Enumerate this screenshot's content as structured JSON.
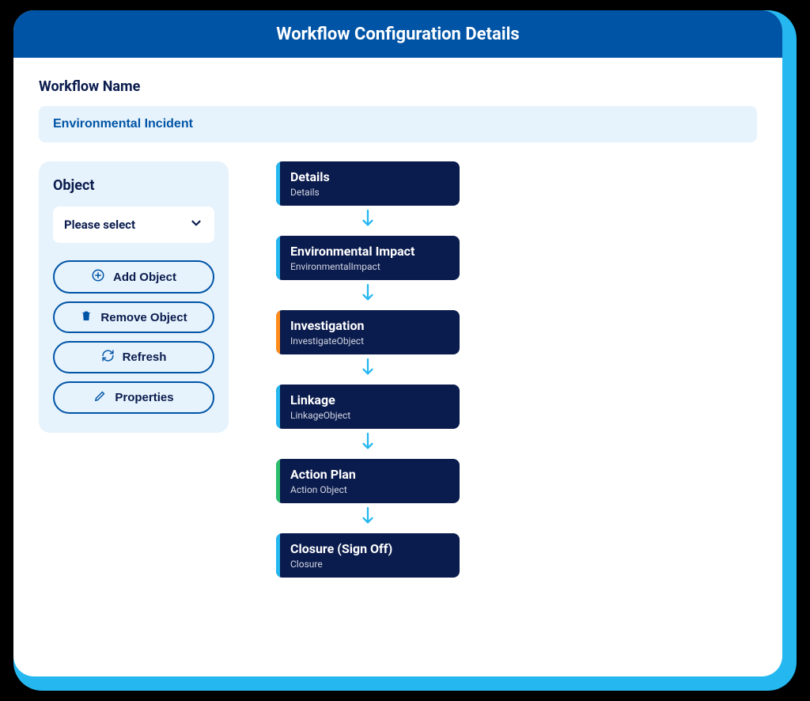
{
  "header": {
    "title": "Workflow Configuration Details"
  },
  "form": {
    "name_label": "Workflow Name",
    "name_value": "Environmental Incident"
  },
  "object_panel": {
    "title": "Object",
    "select_placeholder": "Please select",
    "actions": {
      "add": "Add Object",
      "remove": "Remove Object",
      "refresh": "Refresh",
      "properties": "Properties"
    }
  },
  "flow": {
    "steps": [
      {
        "title": "Details",
        "sub": "Details",
        "accent": "#25b7f0"
      },
      {
        "title": "Environmental Impact",
        "sub": "EnvironmentalImpact",
        "accent": "#25b7f0"
      },
      {
        "title": "Investigation",
        "sub": "InvestigateObject",
        "accent": "#ff8c1a"
      },
      {
        "title": "Linkage",
        "sub": "LinkageObject",
        "accent": "#25b7f0"
      },
      {
        "title": "Action Plan",
        "sub": "Action Object",
        "accent": "#2bbf6b"
      },
      {
        "title": "Closure (Sign Off)",
        "sub": "Closure",
        "accent": "#25b7f0"
      }
    ]
  },
  "colors": {
    "primary": "#0054a6",
    "dark": "#0a1b4d",
    "light": "#e6f3fc",
    "accent_blue": "#25b7f0"
  }
}
